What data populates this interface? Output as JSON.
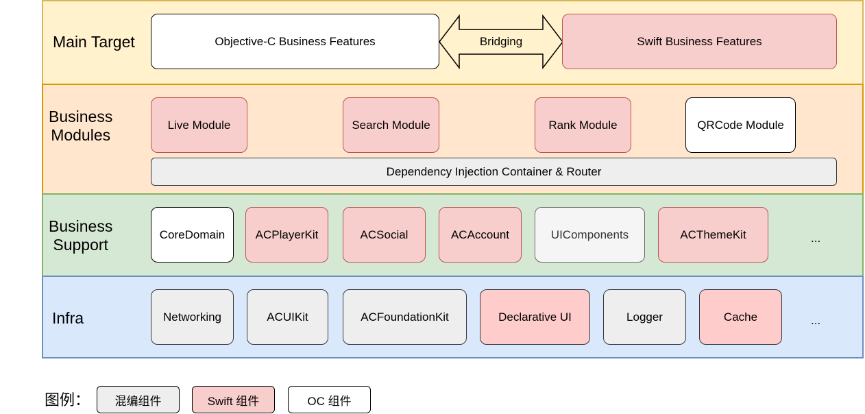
{
  "layers": {
    "main": {
      "label": "Main Target",
      "oc_features": "Objective-C Business Features",
      "bridging": "Bridging",
      "swift_features": "Swift Business Features"
    },
    "business_modules": {
      "label_line1": "Business",
      "label_line2": "Modules",
      "modules": [
        {
          "name": "Live Module",
          "type": "swift"
        },
        {
          "name": "Search Module",
          "type": "swift"
        },
        {
          "name": "Rank Module",
          "type": "swift"
        },
        {
          "name": "QRCode Module",
          "type": "oc"
        }
      ],
      "container": "Dependency Injection Container & Router"
    },
    "business_support": {
      "label_line1": "Business",
      "label_line2": "Support",
      "components": [
        {
          "name": "CoreDomain",
          "type": "oc"
        },
        {
          "name": "ACPlayerKit",
          "type": "swift"
        },
        {
          "name": "ACSocial",
          "type": "swift"
        },
        {
          "name": "ACAccount",
          "type": "swift"
        },
        {
          "name": "UIComponents",
          "type": "mixed"
        },
        {
          "name": "ACThemeKit",
          "type": "swift"
        }
      ],
      "more": "..."
    },
    "infra": {
      "label": "Infra",
      "components": [
        {
          "name": "Networking",
          "type": "mixed"
        },
        {
          "name": "ACUIKit",
          "type": "mixed"
        },
        {
          "name": "ACFoundationKit",
          "type": "mixed"
        },
        {
          "name": "Declarative UI",
          "type": "swift"
        },
        {
          "name": "Logger",
          "type": "mixed"
        },
        {
          "name": "Cache",
          "type": "swift"
        }
      ],
      "more": "..."
    }
  },
  "legend": {
    "title": "图例：",
    "items": [
      {
        "label": "混编组件",
        "type": "mixed"
      },
      {
        "label": "Swift 组件",
        "type": "swift"
      },
      {
        "label": "OC 组件",
        "type": "oc"
      }
    ]
  },
  "colors": {
    "main_fill": "#fff2cc",
    "biz_fill": "#ffe6cc",
    "support_fill": "#d5e8d4",
    "infra_fill": "#dae8fc",
    "swift_fill": "#f8cecc",
    "mixed_fill": "#eeeeee",
    "oc_fill": "#ffffff"
  }
}
